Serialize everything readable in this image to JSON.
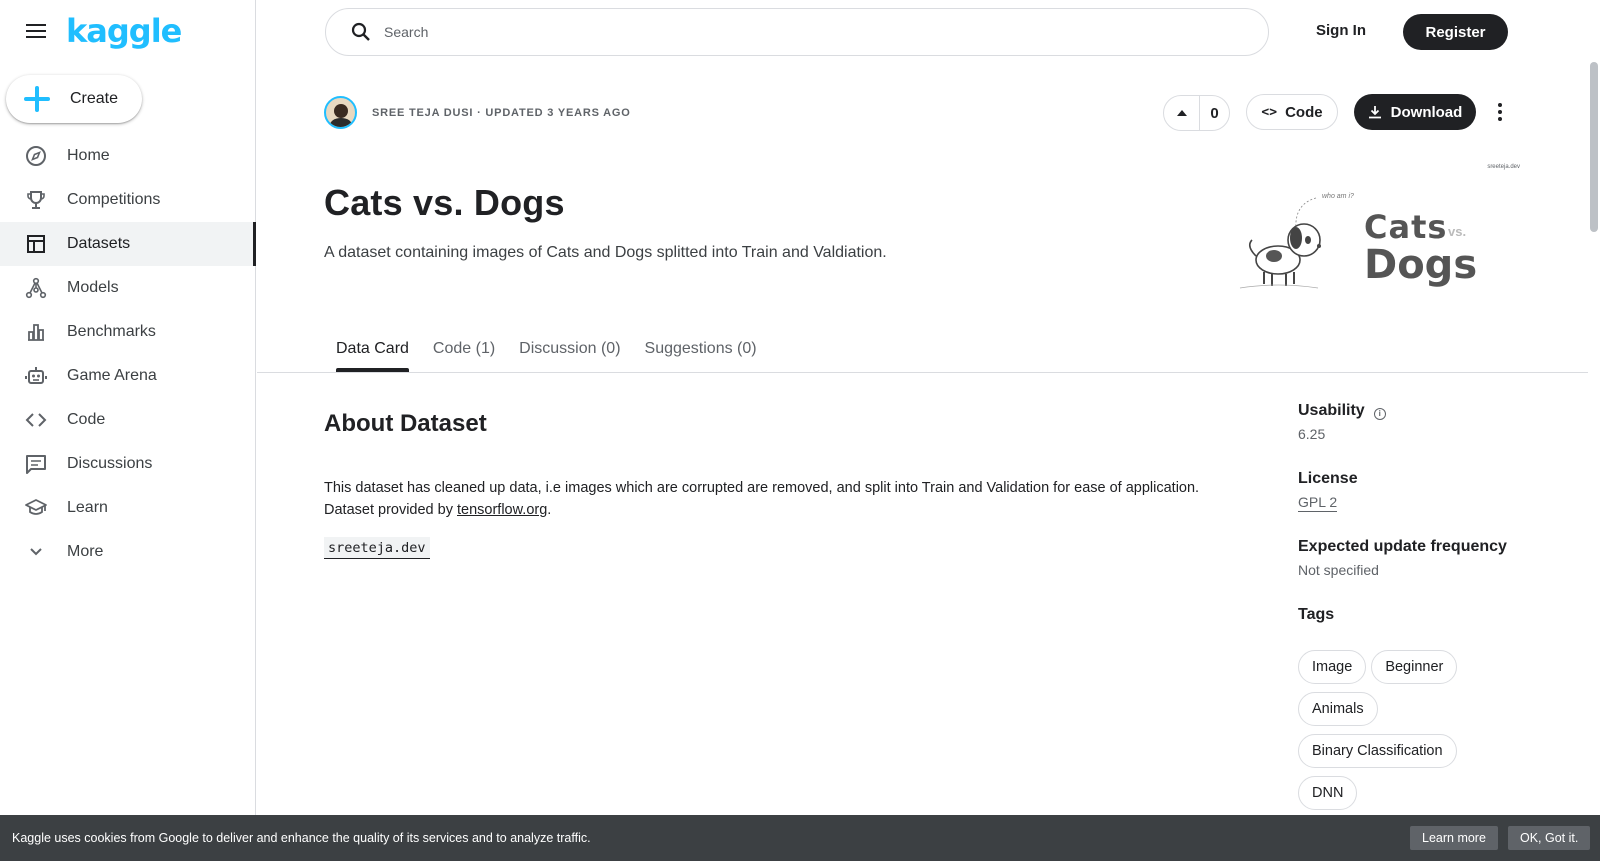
{
  "sidebar": {
    "logo": "kaggle",
    "create_label": "Create",
    "items": [
      {
        "label": "Home",
        "icon": "compass-icon"
      },
      {
        "label": "Competitions",
        "icon": "trophy-icon"
      },
      {
        "label": "Datasets",
        "icon": "table-icon",
        "active": true
      },
      {
        "label": "Models",
        "icon": "models-icon"
      },
      {
        "label": "Benchmarks",
        "icon": "bar-chart-icon"
      },
      {
        "label": "Game Arena",
        "icon": "robot-icon"
      },
      {
        "label": "Code",
        "icon": "code-icon"
      },
      {
        "label": "Discussions",
        "icon": "comments-icon"
      },
      {
        "label": "Learn",
        "icon": "school-icon"
      },
      {
        "label": "More",
        "icon": "chevron-down-icon"
      }
    ]
  },
  "topbar": {
    "search_placeholder": "Search",
    "sign_in": "Sign In",
    "register": "Register"
  },
  "dataset": {
    "owner_line": "SREE TEJA DUSI · UPDATED 3 YEARS AGO",
    "votes": "0",
    "code_label": "Code",
    "download_label": "Download",
    "title": "Cats vs. Dogs",
    "subtitle": "A dataset containing images of Cats and Dogs splitted into Train and Valdiation.",
    "banner": {
      "site": "sreeteja.dev",
      "who": "who am i?",
      "line1": "Cats",
      "vs": "vs.",
      "line2": "Dogs"
    }
  },
  "tabs": [
    {
      "label": "Data Card",
      "active": true
    },
    {
      "label": "Code (1)"
    },
    {
      "label": "Discussion (0)"
    },
    {
      "label": "Suggestions (0)"
    }
  ],
  "about": {
    "heading": "About Dataset",
    "text_part1": "This dataset has cleaned up data, i.e images which are corrupted are removed, and split into Train and Validation for ease of application. Dataset provided by ",
    "link": "tensorflow.org",
    "text_part2": ".",
    "code_chip": "sreeteja.dev"
  },
  "meta": {
    "usability_label": "Usability",
    "usability_value": "6.25",
    "license_label": "License",
    "license_value": "GPL 2",
    "frequency_label": "Expected update frequency",
    "frequency_value": "Not specified",
    "tags_label": "Tags",
    "tags": [
      "Image",
      "Beginner",
      "Animals",
      "Binary Classification",
      "DNN"
    ]
  },
  "cookie": {
    "text": "Kaggle uses cookies from Google to deliver and enhance the quality of its services and to analyze traffic.",
    "learn_more": "Learn more",
    "ok": "OK, Got it."
  },
  "colors": {
    "brand": "#20beff",
    "primary_button": "#202124",
    "cookie_bar": "#3c4043"
  }
}
